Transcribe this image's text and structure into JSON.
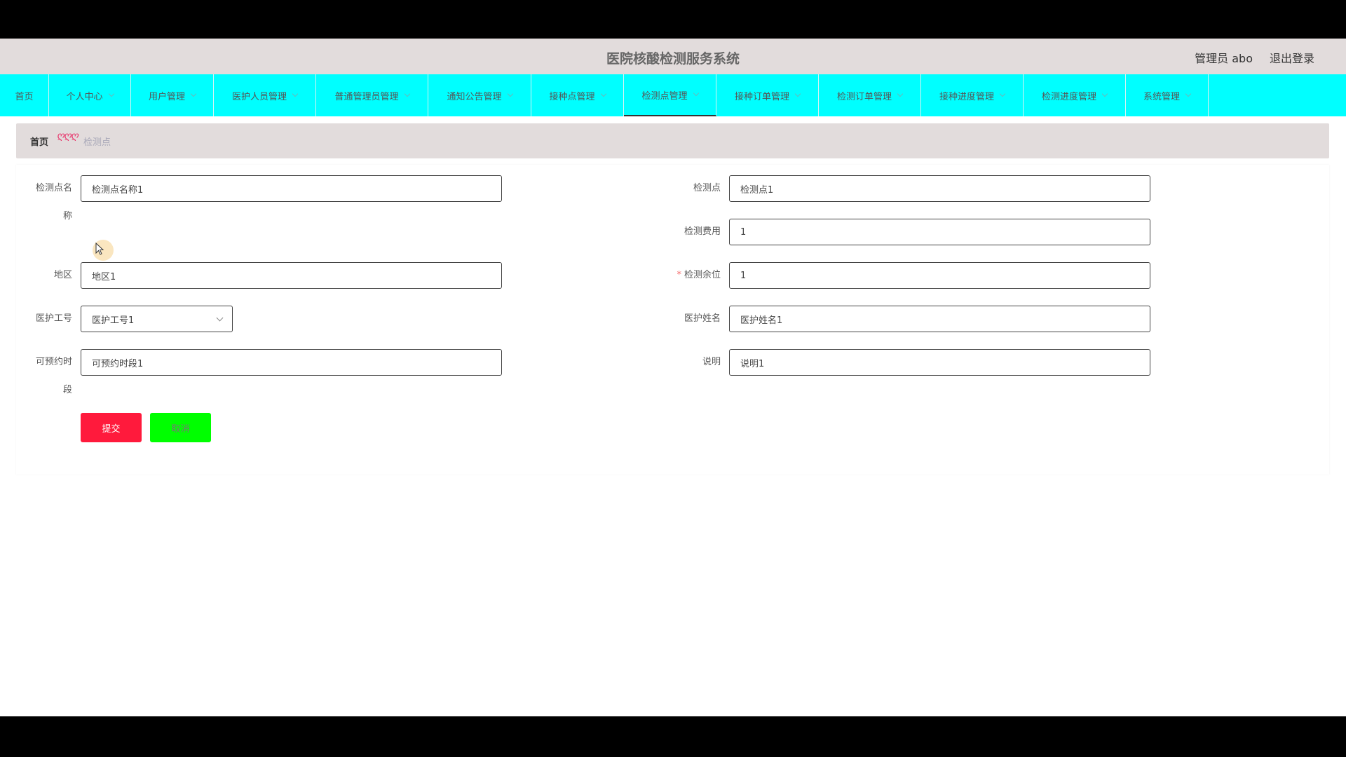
{
  "header": {
    "title": "医院核酸检测服务系统",
    "user": "管理员 abo",
    "logout": "退出登录"
  },
  "nav": {
    "items": [
      {
        "label": "首页"
      },
      {
        "label": "个人中心"
      },
      {
        "label": "用户管理"
      },
      {
        "label": "医护人员管理"
      },
      {
        "label": "普通管理员管理"
      },
      {
        "label": "通知公告管理"
      },
      {
        "label": "接种点管理"
      },
      {
        "label": "检测点管理"
      },
      {
        "label": "接种订单管理"
      },
      {
        "label": "检测订单管理"
      },
      {
        "label": "接种进度管理"
      },
      {
        "label": "检测进度管理"
      },
      {
        "label": "系统管理"
      }
    ],
    "active": "检测点管理"
  },
  "breadcrumb": {
    "home": "首页",
    "separator": "ღღღ",
    "current": "检测点"
  },
  "form": {
    "name": {
      "label_line1": "检测点名",
      "label_line2": "称",
      "value": "检测点名称1"
    },
    "point": {
      "label": "检测点",
      "value": "检测点1"
    },
    "fee": {
      "label": "检测费用",
      "value": "1"
    },
    "region": {
      "label": "地区",
      "value": "地区1"
    },
    "remaining": {
      "label": "检测余位",
      "value": "1",
      "required_mark": "*"
    },
    "staff_id": {
      "label": "医护工号",
      "value": "医护工号1"
    },
    "staff_name": {
      "label": "医护姓名",
      "value": "医护姓名1"
    },
    "slot": {
      "label_line1": "可预约时",
      "label_line2": "段",
      "value": "可预约时段1"
    },
    "note": {
      "label": "说明",
      "value": "说明1"
    },
    "submit": "提交",
    "cancel": "取消"
  },
  "colors": {
    "nav_bg": "#00ffff",
    "header_bg": "#e2dcdc",
    "submit_bg": "#ff1a3c",
    "cancel_bg": "#00ff00"
  }
}
